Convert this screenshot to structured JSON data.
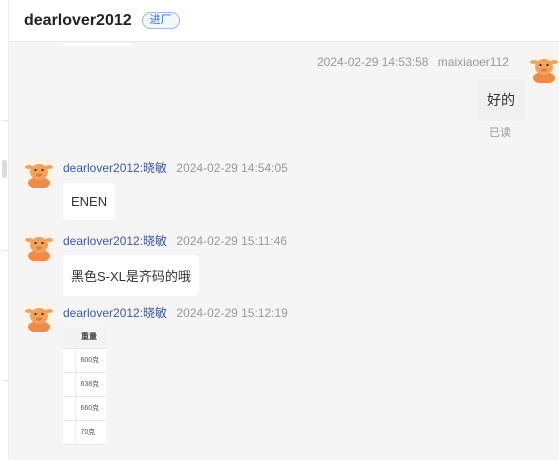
{
  "header": {
    "title": "dearlover2012",
    "badge": "进厂"
  },
  "messages": [
    {
      "direction": "outgoing",
      "time": "2024-02-29 14:53:58",
      "sender": "maixiaoer112",
      "text": "好的",
      "status": "已读"
    },
    {
      "direction": "incoming",
      "sender": "dearlover2012:晓敏",
      "time": "2024-02-29 14:54:05",
      "text": "ENEN"
    },
    {
      "direction": "incoming",
      "sender": "dearlover2012:晓敏",
      "time": "2024-02-29 15:11:46",
      "text": "黑色S-XL是齐码的哦"
    },
    {
      "direction": "incoming",
      "sender": "dearlover2012:晓敏",
      "time": "2024-02-29 15:12:19",
      "image": {
        "header": "重量",
        "rows": [
          "600克",
          "638克",
          "660克",
          "70克"
        ]
      }
    }
  ],
  "colors": {
    "sender_link": "#3d5a9b",
    "badge": "#3a6fd8",
    "background": "#f5f5f5",
    "avatar_bg": "#f3a25e"
  },
  "icons": {
    "avatar": "cartoon-character-avatar"
  }
}
